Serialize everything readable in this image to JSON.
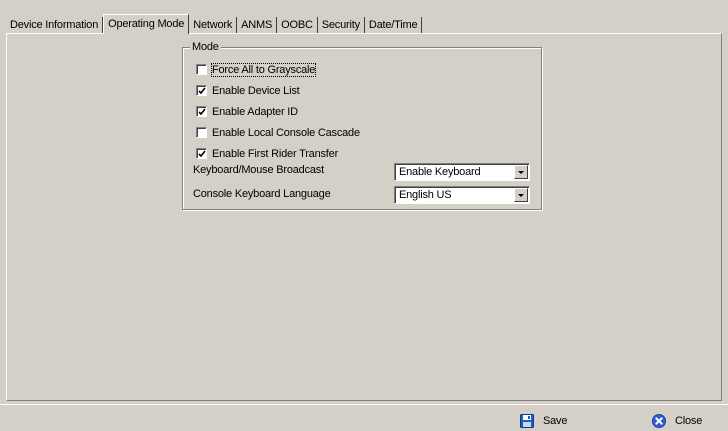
{
  "tabs": [
    "Device Information",
    "Operating Mode",
    "Network",
    "ANMS",
    "OOBC",
    "Security",
    "Date/Time"
  ],
  "active_tab": "Operating Mode",
  "mode_group": {
    "title": "Mode",
    "checkboxes": [
      {
        "label": "Force All to Grayscale",
        "checked": false
      },
      {
        "label": "Enable Device List",
        "checked": true
      },
      {
        "label": "Enable Adapter ID",
        "checked": true
      },
      {
        "label": "Enable Local Console Cascade",
        "checked": false
      },
      {
        "label": "Enable First Rider Transfer",
        "checked": true
      }
    ],
    "broadcast": {
      "label": "Keyboard/Mouse Broadcast",
      "value": "Enable Keyboard"
    },
    "language": {
      "label": "Console Keyboard Language",
      "value": "English US"
    }
  },
  "footer": {
    "save_label": "Save",
    "close_label": "Close"
  },
  "colors": {
    "background": "#d4d0c8",
    "save_icon": "#1f5fc8",
    "close_icon": "#2f5fd8"
  }
}
